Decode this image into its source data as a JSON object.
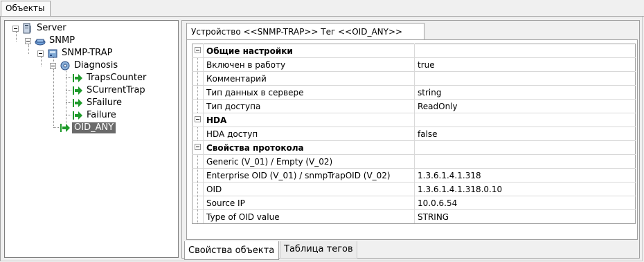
{
  "top_tab": {
    "label": "Объекты"
  },
  "tree": {
    "nodes": [
      {
        "label": "Server"
      },
      {
        "label": "SNMP"
      },
      {
        "label": "SNMP-TRAP"
      },
      {
        "label": "Diagnosis"
      },
      {
        "label": "TrapsCounter"
      },
      {
        "label": "SCurrentTrap"
      },
      {
        "label": "SFailure"
      },
      {
        "label": "Failure"
      },
      {
        "label": "OID_ANY"
      }
    ]
  },
  "device_tab": {
    "label": "Устройство <<SNMP-TRAP>> Тег  <<OID_ANY>>"
  },
  "properties": {
    "rows": [
      {
        "name": "Общие настройки",
        "value": ""
      },
      {
        "name": "Включен в работу",
        "value": "true"
      },
      {
        "name": "Комментарий",
        "value": ""
      },
      {
        "name": "Тип данных в сервере",
        "value": "string"
      },
      {
        "name": "Тип доступа",
        "value": "ReadOnly"
      },
      {
        "name": "HDA",
        "value": ""
      },
      {
        "name": "HDA доступ",
        "value": "false"
      },
      {
        "name": "Свойства протокола",
        "value": ""
      },
      {
        "name": "Generic (V_01) / Empty (V_02)",
        "value": ""
      },
      {
        "name": "Enterprise OID (V_01) / snmpTrapOID (V_02)",
        "value": "1.3.6.1.4.1.318"
      },
      {
        "name": "OID",
        "value": "1.3.6.1.4.1.318.0.10"
      },
      {
        "name": "Source IP",
        "value": "10.0.6.54"
      },
      {
        "name": "Type of OID value",
        "value": "STRING"
      }
    ]
  },
  "bottom_tabs": [
    {
      "label": "Свойства объекта"
    },
    {
      "label": "Таблица тегов"
    }
  ],
  "colors": {
    "selection": "#6a6a6a",
    "tag_arrow": "#1e9a2a",
    "border": "#a0a0a0"
  }
}
